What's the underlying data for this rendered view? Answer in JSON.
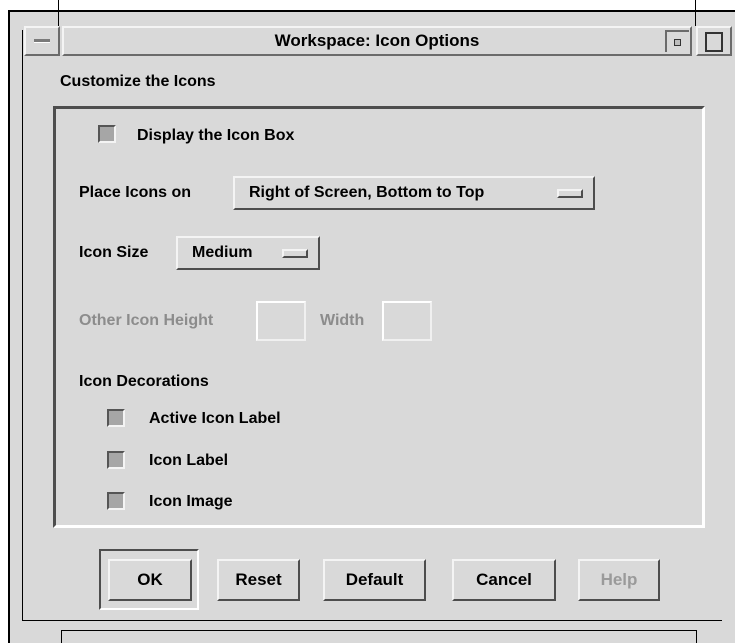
{
  "window": {
    "title": "Workspace: Icon Options"
  },
  "dialog": {
    "heading": "Customize the Icons",
    "icon_box": {
      "label": "Display the Icon Box"
    },
    "placement": {
      "label": "Place Icons on",
      "value": "Right of Screen, Bottom to Top"
    },
    "size": {
      "label": "Icon Size",
      "value": "Medium"
    },
    "other_size": {
      "height_label": "Other Icon Height",
      "width_label": "Width",
      "height_value": "",
      "width_value": ""
    },
    "decorations": {
      "heading": "Icon Decorations",
      "items": [
        {
          "label": "Active Icon Label"
        },
        {
          "label": "Icon Label"
        },
        {
          "label": "Icon Image"
        }
      ]
    }
  },
  "buttons": {
    "ok": "OK",
    "reset": "Reset",
    "default": "Default",
    "cancel": "Cancel",
    "help": "Help"
  },
  "colors": {
    "background": "#d9d9d9",
    "shadow_dark": "#4d4d4d",
    "highlight": "#f4f4f4",
    "disabled_text": "#8c8c8c",
    "checkbox_fill": "#a6a6a6"
  }
}
